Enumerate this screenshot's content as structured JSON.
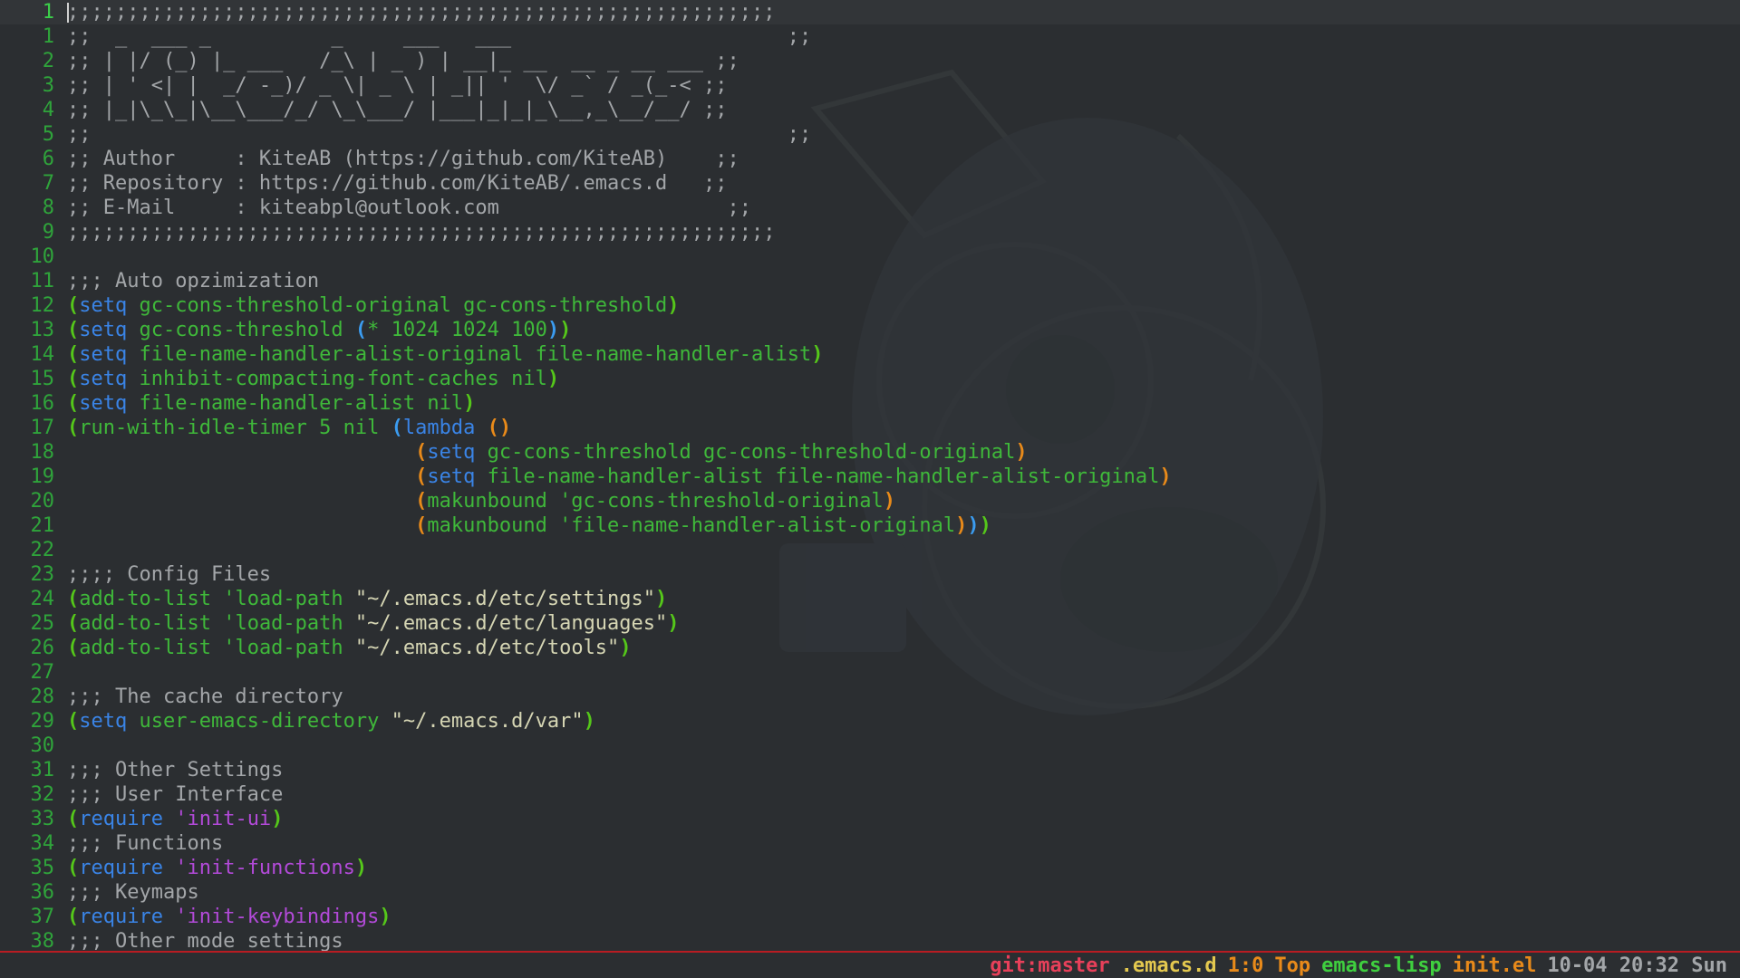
{
  "editor": {
    "lines": [
      {
        "n": "1",
        "current": true,
        "segs": [
          {
            "c": "comment",
            "t": ";;;;;;;;;;;;;;;;;;;;;;;;;;;;;;;;;;;;;;;;;;;;;;;;;;;;;;;;;;;"
          }
        ]
      },
      {
        "n": "1",
        "segs": [
          {
            "c": "comment",
            "t": ";;  _  ___ _          _     ___   ___                       ;;"
          }
        ]
      },
      {
        "n": "2",
        "segs": [
          {
            "c": "comment",
            "t": ";; | |/ (_) |_ ___   /_\\ | _ ) | __|_ __  __ _ __ ___ ;;"
          }
        ]
      },
      {
        "n": "3",
        "segs": [
          {
            "c": "comment",
            "t": ";; | ' <| |  _/ -_)/ _ \\| _ \\ | _|| '  \\/ _` / _(_-< ;;"
          }
        ]
      },
      {
        "n": "4",
        "segs": [
          {
            "c": "comment",
            "t": ";; |_|\\_\\_|\\__\\___/_/ \\_\\___/ |___|_|_|_\\__,_\\__/__/ ;;"
          }
        ]
      },
      {
        "n": "5",
        "segs": [
          {
            "c": "comment",
            "t": ";;                                                          ;;"
          }
        ]
      },
      {
        "n": "6",
        "segs": [
          {
            "c": "comment",
            "t": ";; Author     : KiteAB (https://github.com/KiteAB)    ;;"
          }
        ]
      },
      {
        "n": "7",
        "segs": [
          {
            "c": "comment",
            "t": ";; Repository : https://github.com/KiteAB/.emacs.d   ;;"
          }
        ]
      },
      {
        "n": "8",
        "segs": [
          {
            "c": "comment",
            "t": ";; E-Mail     : kiteabpl@outlook.com                   ;;"
          }
        ]
      },
      {
        "n": "9",
        "segs": [
          {
            "c": "comment",
            "t": ";;;;;;;;;;;;;;;;;;;;;;;;;;;;;;;;;;;;;;;;;;;;;;;;;;;;;;;;;;;"
          }
        ]
      },
      {
        "n": "10",
        "segs": []
      },
      {
        "n": "11",
        "segs": [
          {
            "c": "comment",
            "t": ";;; Auto opzimization"
          }
        ]
      },
      {
        "n": "12",
        "segs": [
          {
            "c": "paren-g",
            "t": "("
          },
          {
            "c": "kw",
            "t": "setq"
          },
          {
            "c": "var",
            "t": " gc-cons-threshold-original gc-cons-threshold"
          },
          {
            "c": "paren-g",
            "t": ")"
          }
        ]
      },
      {
        "n": "13",
        "segs": [
          {
            "c": "paren-g",
            "t": "("
          },
          {
            "c": "kw",
            "t": "setq"
          },
          {
            "c": "var",
            "t": " gc-cons-threshold "
          },
          {
            "c": "paren-b",
            "t": "("
          },
          {
            "c": "num",
            "t": "* 1024 1024 100"
          },
          {
            "c": "paren-b",
            "t": ")"
          },
          {
            "c": "paren-g",
            "t": ")"
          }
        ]
      },
      {
        "n": "14",
        "segs": [
          {
            "c": "paren-g",
            "t": "("
          },
          {
            "c": "kw",
            "t": "setq"
          },
          {
            "c": "var",
            "t": " file-name-handler-alist-original file-name-handler-alist"
          },
          {
            "c": "paren-g",
            "t": ")"
          }
        ]
      },
      {
        "n": "15",
        "segs": [
          {
            "c": "paren-g",
            "t": "("
          },
          {
            "c": "kw",
            "t": "setq"
          },
          {
            "c": "var",
            "t": " inhibit-compacting-font-caches nil"
          },
          {
            "c": "paren-g",
            "t": ")"
          }
        ]
      },
      {
        "n": "16",
        "segs": [
          {
            "c": "paren-g",
            "t": "("
          },
          {
            "c": "kw",
            "t": "setq"
          },
          {
            "c": "var",
            "t": " file-name-handler-alist nil"
          },
          {
            "c": "paren-g",
            "t": ")"
          }
        ]
      },
      {
        "n": "17",
        "segs": [
          {
            "c": "paren-g",
            "t": "("
          },
          {
            "c": "fn",
            "t": "run-with-idle-timer 5 nil "
          },
          {
            "c": "paren-b",
            "t": "("
          },
          {
            "c": "kw",
            "t": "lambda"
          },
          {
            "c": "plain",
            "t": " "
          },
          {
            "c": "paren-o",
            "t": "()"
          }
        ]
      },
      {
        "n": "18",
        "segs": [
          {
            "c": "plain",
            "t": "                             "
          },
          {
            "c": "paren-o",
            "t": "("
          },
          {
            "c": "kw",
            "t": "setq"
          },
          {
            "c": "var",
            "t": " gc-cons-threshold gc-cons-threshold-original"
          },
          {
            "c": "paren-o",
            "t": ")"
          }
        ]
      },
      {
        "n": "19",
        "segs": [
          {
            "c": "plain",
            "t": "                             "
          },
          {
            "c": "paren-o",
            "t": "("
          },
          {
            "c": "kw",
            "t": "setq"
          },
          {
            "c": "var",
            "t": " file-name-handler-alist file-name-handler-alist-original"
          },
          {
            "c": "paren-o",
            "t": ")"
          }
        ]
      },
      {
        "n": "20",
        "segs": [
          {
            "c": "plain",
            "t": "                             "
          },
          {
            "c": "paren-o",
            "t": "("
          },
          {
            "c": "fn",
            "t": "makunbound "
          },
          {
            "c": "quote",
            "t": "'gc-cons-threshold-original"
          },
          {
            "c": "paren-o",
            "t": ")"
          }
        ]
      },
      {
        "n": "21",
        "segs": [
          {
            "c": "plain",
            "t": "                             "
          },
          {
            "c": "paren-o",
            "t": "("
          },
          {
            "c": "fn",
            "t": "makunbound "
          },
          {
            "c": "quote",
            "t": "'file-name-handler-alist-original"
          },
          {
            "c": "paren-o",
            "t": ")"
          },
          {
            "c": "paren-b",
            "t": ")"
          },
          {
            "c": "paren-g",
            "t": ")"
          }
        ]
      },
      {
        "n": "22",
        "segs": []
      },
      {
        "n": "23",
        "segs": [
          {
            "c": "comment",
            "t": ";;;; Config Files"
          }
        ]
      },
      {
        "n": "24",
        "segs": [
          {
            "c": "paren-g",
            "t": "("
          },
          {
            "c": "fn",
            "t": "add-to-list "
          },
          {
            "c": "quote",
            "t": "'load-path "
          },
          {
            "c": "str",
            "t": "\"~/.emacs.d/etc/settings\""
          },
          {
            "c": "paren-g",
            "t": ")"
          }
        ]
      },
      {
        "n": "25",
        "segs": [
          {
            "c": "paren-g",
            "t": "("
          },
          {
            "c": "fn",
            "t": "add-to-list "
          },
          {
            "c": "quote",
            "t": "'load-path "
          },
          {
            "c": "str",
            "t": "\"~/.emacs.d/etc/languages\""
          },
          {
            "c": "paren-g",
            "t": ")"
          }
        ]
      },
      {
        "n": "26",
        "segs": [
          {
            "c": "paren-g",
            "t": "("
          },
          {
            "c": "fn",
            "t": "add-to-list "
          },
          {
            "c": "quote",
            "t": "'load-path "
          },
          {
            "c": "str",
            "t": "\"~/.emacs.d/etc/tools\""
          },
          {
            "c": "paren-g",
            "t": ")"
          }
        ]
      },
      {
        "n": "27",
        "segs": []
      },
      {
        "n": "28",
        "segs": [
          {
            "c": "comment",
            "t": ";;; The cache directory"
          }
        ]
      },
      {
        "n": "29",
        "segs": [
          {
            "c": "paren-g",
            "t": "("
          },
          {
            "c": "kw",
            "t": "setq"
          },
          {
            "c": "var",
            "t": " user-emacs-directory "
          },
          {
            "c": "str",
            "t": "\"~/.emacs.d/var\""
          },
          {
            "c": "paren-g",
            "t": ")"
          }
        ]
      },
      {
        "n": "30",
        "segs": []
      },
      {
        "n": "31",
        "segs": [
          {
            "c": "comment",
            "t": ";;; Other Settings"
          }
        ]
      },
      {
        "n": "32",
        "segs": [
          {
            "c": "comment",
            "t": ";;; User Interface"
          }
        ]
      },
      {
        "n": "33",
        "segs": [
          {
            "c": "paren-g",
            "t": "("
          },
          {
            "c": "kw",
            "t": "require"
          },
          {
            "c": "plain",
            "t": " "
          },
          {
            "c": "sym",
            "t": "'init-ui"
          },
          {
            "c": "paren-g",
            "t": ")"
          }
        ]
      },
      {
        "n": "34",
        "segs": [
          {
            "c": "comment",
            "t": ";;; Functions"
          }
        ]
      },
      {
        "n": "35",
        "segs": [
          {
            "c": "paren-g",
            "t": "("
          },
          {
            "c": "kw",
            "t": "require"
          },
          {
            "c": "plain",
            "t": " "
          },
          {
            "c": "sym",
            "t": "'init-functions"
          },
          {
            "c": "paren-g",
            "t": ")"
          }
        ]
      },
      {
        "n": "36",
        "segs": [
          {
            "c": "comment",
            "t": ";;; Keymaps"
          }
        ]
      },
      {
        "n": "37",
        "segs": [
          {
            "c": "paren-g",
            "t": "("
          },
          {
            "c": "kw",
            "t": "require"
          },
          {
            "c": "plain",
            "t": " "
          },
          {
            "c": "sym",
            "t": "'init-keybindings"
          },
          {
            "c": "paren-g",
            "t": ")"
          }
        ]
      },
      {
        "n": "38",
        "segs": [
          {
            "c": "comment",
            "t": ";;; Other mode settings"
          }
        ]
      }
    ]
  },
  "modeline": {
    "git": "git:master",
    "project": ".emacs.d",
    "position": "1:0",
    "scroll": "Top",
    "major_mode": "emacs-lisp",
    "file": "init.el",
    "datetime": "10-04 20:32 Sun"
  },
  "colors": {
    "background": "#2b2e31",
    "line_number": "#2fa43b",
    "modeline_border": "#b81c22"
  }
}
